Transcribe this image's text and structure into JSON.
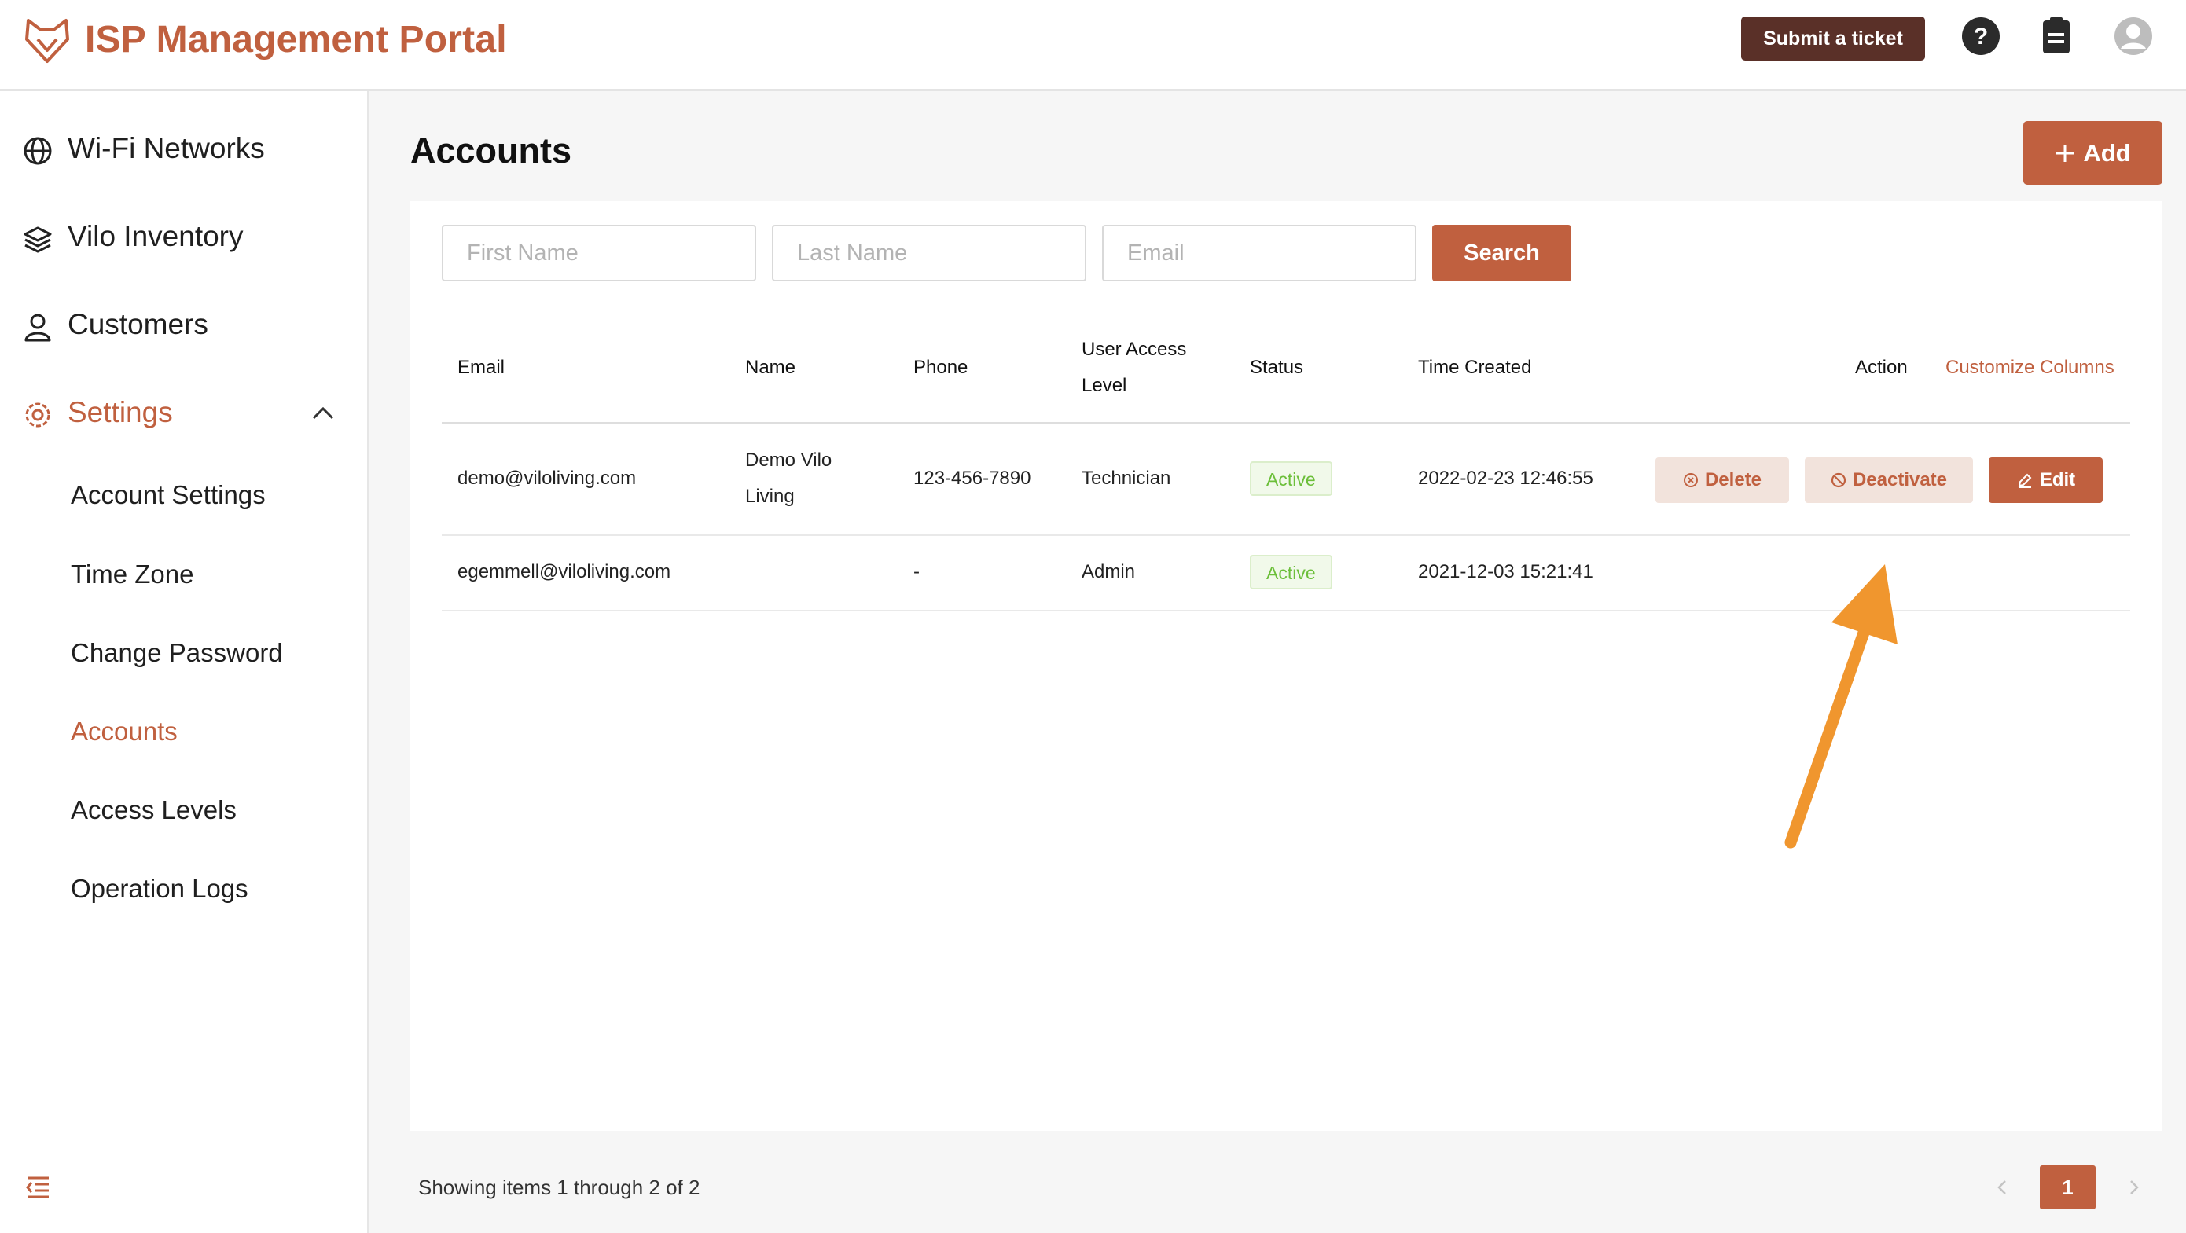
{
  "header": {
    "app_title": "ISP Management Portal",
    "submit_ticket_label": "Submit a ticket",
    "icons": [
      "help-icon",
      "clipboard-icon",
      "user-avatar-icon"
    ]
  },
  "sidebar": {
    "items": [
      {
        "label": "Wi-Fi Networks",
        "icon": "globe-icon"
      },
      {
        "label": "Vilo Inventory",
        "icon": "layers-icon"
      },
      {
        "label": "Customers",
        "icon": "user-icon"
      },
      {
        "label": "Settings",
        "icon": "gear-icon",
        "expanded": true
      }
    ],
    "settings_children": [
      {
        "label": "Account Settings",
        "active": false
      },
      {
        "label": "Time Zone",
        "active": false
      },
      {
        "label": "Change Password",
        "active": false
      },
      {
        "label": "Accounts",
        "active": true
      },
      {
        "label": "Access Levels",
        "active": false
      },
      {
        "label": "Operation Logs",
        "active": false
      }
    ]
  },
  "main": {
    "title": "Accounts",
    "add_label": "Add",
    "search": {
      "first_name_placeholder": "First Name",
      "last_name_placeholder": "Last Name",
      "email_placeholder": "Email",
      "button_label": "Search"
    },
    "table": {
      "columns": {
        "email": "Email",
        "name": "Name",
        "phone": "Phone",
        "access_line1": "User Access",
        "access_line2": "Level",
        "status": "Status",
        "time_created": "Time Created",
        "action": "Action",
        "customize": "Customize Columns"
      },
      "rows": [
        {
          "email": "demo@viloliving.com",
          "name_line1": "Demo Vilo",
          "name_line2": "Living",
          "phone": "123-456-7890",
          "access_level": "Technician",
          "status": "Active",
          "time_created": "2022-02-23 12:46:55",
          "actions": {
            "delete": "Delete",
            "deactivate": "Deactivate",
            "edit": "Edit"
          }
        },
        {
          "email": "egemmell@viloliving.com",
          "name_line1": "",
          "name_line2": "",
          "phone": "-",
          "access_level": "Admin",
          "status": "Active",
          "time_created": "2021-12-03 15:21:41"
        }
      ]
    }
  },
  "pagination": {
    "summary": "Showing items 1 through 2 of 2",
    "current_page": "1"
  },
  "colors": {
    "brand": "#c0603f",
    "ticket_button": "#5a3028",
    "status_active": "#6cbf3a",
    "annotation_arrow": "#f0962e"
  }
}
